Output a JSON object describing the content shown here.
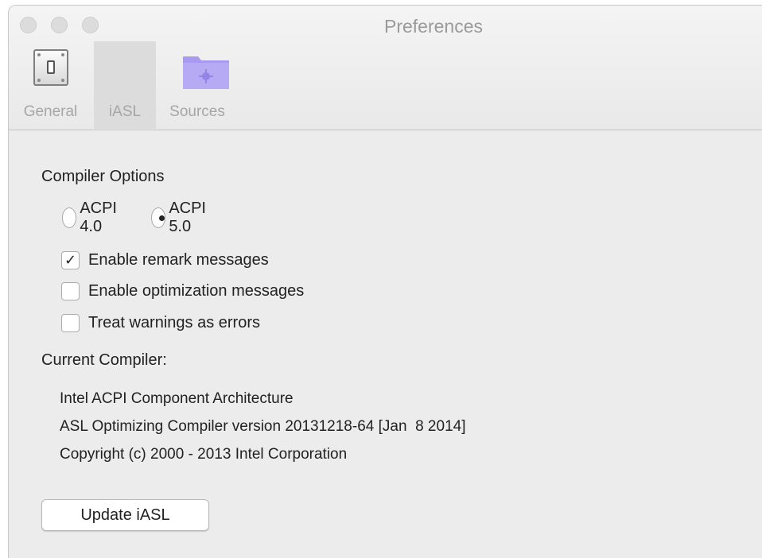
{
  "window": {
    "title": "Preferences"
  },
  "toolbar": {
    "items": [
      {
        "label": "General",
        "icon": "toggle-switch-icon",
        "selected": false
      },
      {
        "label": "iASL",
        "icon": "",
        "selected": true
      },
      {
        "label": "Sources",
        "icon": "folder-icon",
        "selected": false
      }
    ],
    "folder_color": "#a99af0"
  },
  "compiler_options": {
    "title": "Compiler Options",
    "acpi_options": [
      {
        "label": "ACPI 4.0",
        "selected": false
      },
      {
        "label": "ACPI 5.0",
        "selected": true
      }
    ],
    "checkboxes": [
      {
        "label": "Enable remark messages",
        "checked": true
      },
      {
        "label": "Enable optimization messages",
        "checked": false
      },
      {
        "label": "Treat warnings as errors",
        "checked": false
      }
    ]
  },
  "current_compiler": {
    "title": "Current Compiler:",
    "lines": [
      "Intel ACPI Component Architecture",
      "ASL Optimizing Compiler version 20131218-64 [Jan  8 2014]",
      "Copyright (c) 2000 - 2013 Intel Corporation"
    ]
  },
  "update_button": {
    "label": "Update iASL"
  },
  "check_glyph": "✓"
}
